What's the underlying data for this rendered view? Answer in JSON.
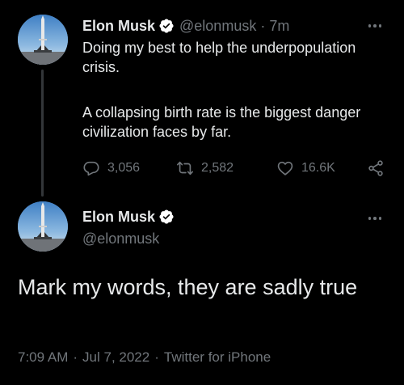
{
  "reply_tweet": {
    "display_name": "Elon Musk",
    "handle": "@elonmusk",
    "separator": "·",
    "time": "7m",
    "text_p1": "Doing my best to help the underpopulation crisis.",
    "text_p2": "A collapsing birth rate is the biggest danger civilization faces by far.",
    "stats": {
      "replies": "3,056",
      "retweets": "2,582",
      "likes": "16.6K"
    }
  },
  "main_tweet": {
    "display_name": "Elon Musk",
    "handle": "@elonmusk",
    "text": "Mark my words, they are sadly true",
    "time": "7:09 AM",
    "separator_1": "·",
    "date": "Jul 7, 2022",
    "separator_2": "·",
    "source": "Twitter for iPhone"
  },
  "colors": {
    "background": "#000000",
    "text_primary": "#e7e9ea",
    "text_secondary": "#71767b",
    "verified_badge": "#ffffff"
  },
  "icons": {
    "verified": "verified-badge-icon",
    "more": "more-options-icon",
    "reply": "reply-bubble-icon",
    "retweet": "retweet-icon",
    "like": "heart-icon",
    "share": "share-icon",
    "avatar": "rocket-launch-avatar"
  }
}
